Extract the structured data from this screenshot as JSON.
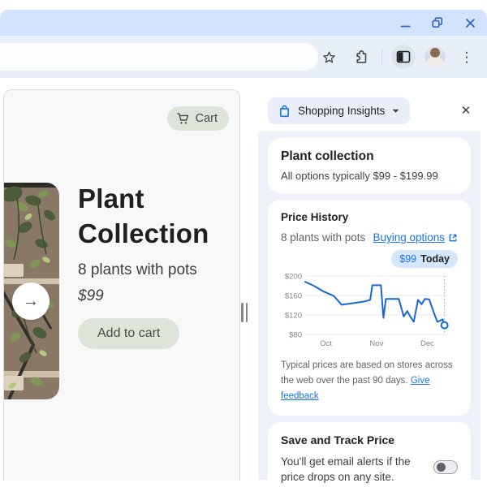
{
  "window": {
    "controls": [
      "minimize",
      "restore",
      "close"
    ]
  },
  "toolbar": {
    "icons": [
      "bookmark-star",
      "extensions-puzzle",
      "side-panel-toggle",
      "profile-avatar",
      "more-menu-dots"
    ],
    "menu_glyph": "⋮"
  },
  "page": {
    "cart_button_label": "Cart",
    "product": {
      "title": "Plant Collection",
      "subtitle": "8 plants with pots",
      "price": "$99",
      "add_to_cart_label": "Add to cart",
      "next_arrow_glyph": "→"
    }
  },
  "side_panel": {
    "header_title": "Shopping Insights",
    "close_glyph": "✕",
    "summary_card": {
      "title": "Plant collection",
      "subtitle": "All options typically $99 - $199.99"
    },
    "price_history_card": {
      "title": "Price History",
      "subtitle": "8 plants with pots",
      "buying_options_label": "Buying options",
      "badge_price": "$99",
      "badge_label": "Today",
      "disclaimer": "Typical prices are based on stores across the web over the past 90 days.",
      "feedback_link_label": "Give feedback"
    },
    "track_card": {
      "title": "Save and Track Price",
      "body": "You'll get email alerts if the price drops on any site."
    }
  },
  "chart_data": {
    "type": "line",
    "title": "Price History",
    "y_tick_prefix": "$",
    "y_ticks": [
      200,
      160,
      120,
      80
    ],
    "ylim": [
      80,
      200
    ],
    "x_ticks": [
      {
        "label": "Oct",
        "frac": 0.145
      },
      {
        "label": "Nov",
        "frac": 0.5
      },
      {
        "label": "Dec",
        "frac": 0.855
      }
    ],
    "grid": true,
    "legend": false,
    "series": [
      {
        "name": "Typical price (USD)",
        "color": "#1967d2",
        "points": [
          [
            0.0,
            188
          ],
          [
            0.06,
            180
          ],
          [
            0.13,
            168
          ],
          [
            0.2,
            159
          ],
          [
            0.255,
            141
          ],
          [
            0.33,
            144
          ],
          [
            0.42,
            148
          ],
          [
            0.455,
            151
          ],
          [
            0.47,
            181
          ],
          [
            0.53,
            181
          ],
          [
            0.548,
            114
          ],
          [
            0.565,
            153
          ],
          [
            0.655,
            153
          ],
          [
            0.69,
            117
          ],
          [
            0.715,
            128
          ],
          [
            0.733,
            118
          ],
          [
            0.76,
            106
          ],
          [
            0.79,
            151
          ],
          [
            0.815,
            142
          ],
          [
            0.838,
            153
          ],
          [
            0.868,
            152
          ],
          [
            0.905,
            121
          ],
          [
            0.925,
            106
          ],
          [
            0.95,
            109
          ],
          [
            0.962,
            111
          ],
          [
            0.975,
            99
          ]
        ]
      }
    ],
    "today_marker": {
      "frac": 0.975,
      "value": 99,
      "label": "$99 Today"
    },
    "colors": {
      "grid": "#e8eaee",
      "axis_text": "#80868b",
      "marker_line": "#7baaf7"
    }
  },
  "colors": {
    "titlebar": "#d3e3fd",
    "toolbar": "#e9eff9",
    "accent_blue": "#1a73e8",
    "sage_button": "#dfe4da",
    "panel_background": "#eef1f9",
    "badge_background": "#d6e6fd",
    "chart_line": "#1967d2"
  }
}
